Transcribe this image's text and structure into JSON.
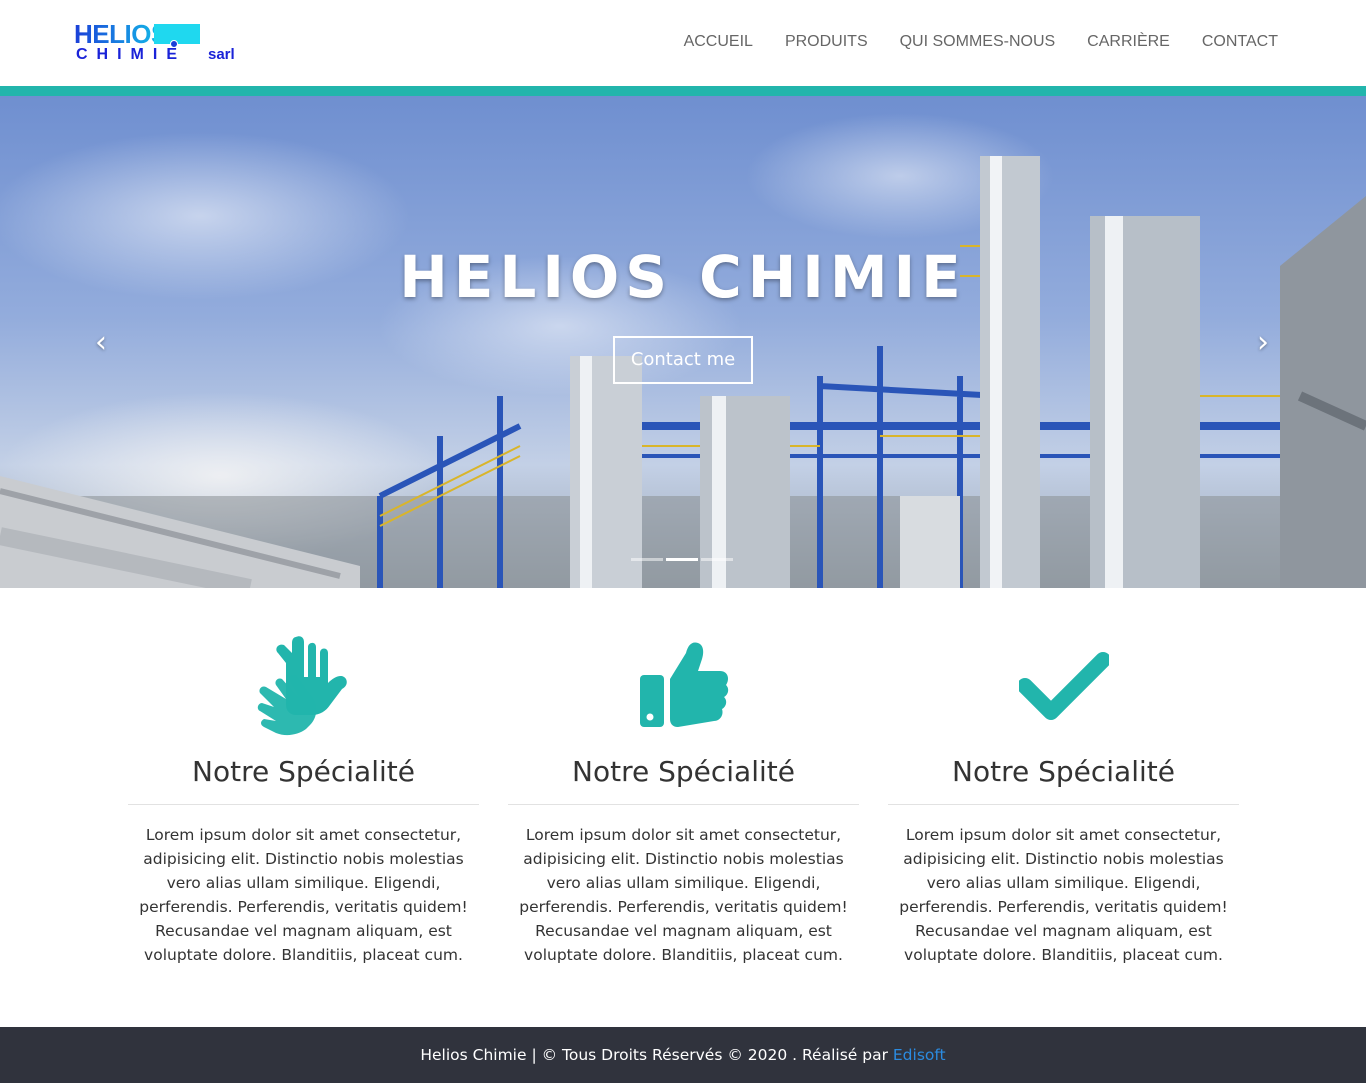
{
  "brand": {
    "logo_line1": "HELIOS",
    "logo_line2": "CHIMIE",
    "logo_suffix": "sarl"
  },
  "nav": {
    "items": [
      {
        "label": "ACCUEIL"
      },
      {
        "label": "PRODUITS"
      },
      {
        "label": "QUI SOMMES-NOUS"
      },
      {
        "label": "CARRIÈRE"
      },
      {
        "label": "CONTACT"
      }
    ]
  },
  "colors": {
    "accent": "#22b5ac",
    "footer_bg": "#30333d",
    "link": "#2b8be0"
  },
  "hero": {
    "title": "HELIOS CHIMIE",
    "button_label": "Contact me",
    "prev_icon": "chevron-left-icon",
    "next_icon": "chevron-right-icon",
    "slides_count": 3,
    "active_slide": 2
  },
  "features": [
    {
      "icon": "sign-language-icon",
      "title": "Notre Spécialité",
      "text": "Lorem ipsum dolor sit amet consectetur, adipisicing elit. Distinctio nobis molestias vero alias ullam similique. Eligendi, perferendis. Perferendis, veritatis quidem! Recusandae vel magnam aliquam, est voluptate dolore. Blanditiis, placeat cum."
    },
    {
      "icon": "thumbs-up-icon",
      "title": "Notre Spécialité",
      "text": "Lorem ipsum dolor sit amet consectetur, adipisicing elit. Distinctio nobis molestias vero alias ullam similique. Eligendi, perferendis. Perferendis, veritatis quidem! Recusandae vel magnam aliquam, est voluptate dolore. Blanditiis, placeat cum."
    },
    {
      "icon": "check-icon",
      "title": "Notre Spécialité",
      "text": "Lorem ipsum dolor sit amet consectetur, adipisicing elit. Distinctio nobis molestias vero alias ullam similique. Eligendi, perferendis. Perferendis, veritatis quidem! Recusandae vel magnam aliquam, est voluptate dolore. Blanditiis, placeat cum."
    }
  ],
  "footer": {
    "text": "Helios Chimie | © Tous Droits Réservés © 2020 . Réalisé par ",
    "link_label": "Edisoft"
  }
}
